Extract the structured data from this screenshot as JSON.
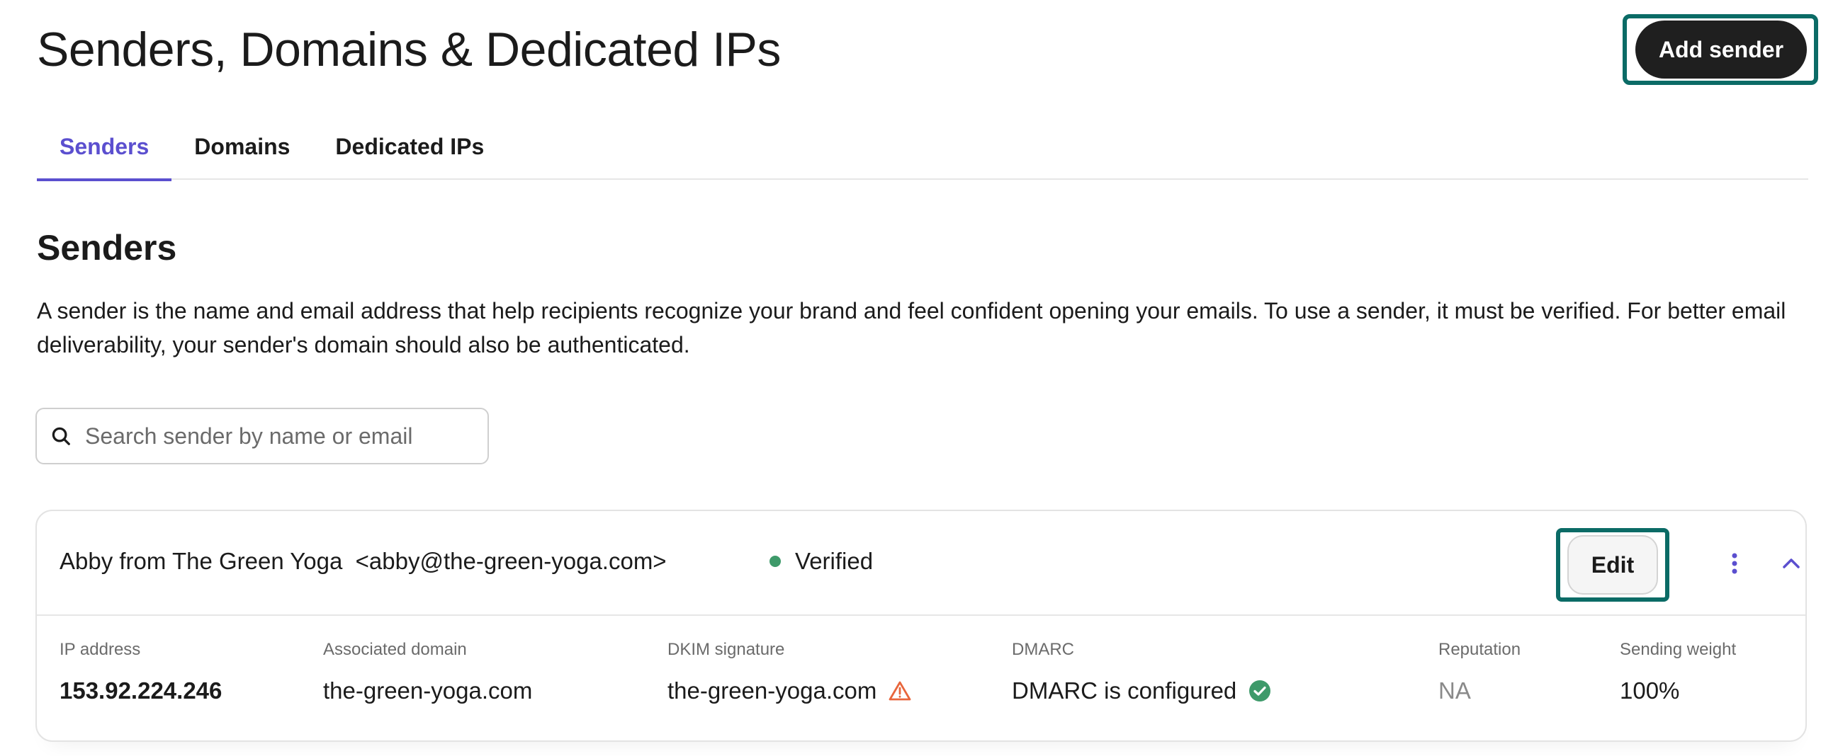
{
  "header": {
    "title": "Senders, Domains & Dedicated IPs",
    "add_sender_label": "Add sender"
  },
  "tabs": [
    {
      "label": "Senders",
      "active": true
    },
    {
      "label": "Domains",
      "active": false
    },
    {
      "label": "Dedicated IPs",
      "active": false
    }
  ],
  "section": {
    "title": "Senders",
    "description": "A sender is the name and email address that help recipients recognize your brand and feel confident opening your emails. To use a sender, it must be verified. For better email deliverability, your sender's domain should also be authenticated."
  },
  "search": {
    "placeholder": "Search sender by name or email",
    "value": ""
  },
  "sender": {
    "name_email": "Abby from The Green Yoga  <abby@the-green-yoga.com>",
    "status": "Verified",
    "status_color": "#3e9a6a",
    "edit_label": "Edit",
    "details": {
      "ip_label": "IP address",
      "ip_value": "153.92.224.246",
      "domain_label": "Associated domain",
      "domain_value": "the-green-yoga.com",
      "dkim_label": "DKIM signature",
      "dkim_value": "the-green-yoga.com",
      "dkim_icon": "warning-icon",
      "dmarc_label": "DMARC",
      "dmarc_value": "DMARC is configured",
      "dmarc_icon": "check-circle-icon",
      "reputation_label": "Reputation",
      "reputation_value": "NA",
      "weight_label": "Sending weight",
      "weight_value": "100%"
    }
  },
  "colors": {
    "accent": "#5b4fcf",
    "focus_ring": "#0b6b66",
    "primary_button": "#1f1f1f",
    "warning": "#e8663c",
    "success": "#3e9a6a"
  }
}
